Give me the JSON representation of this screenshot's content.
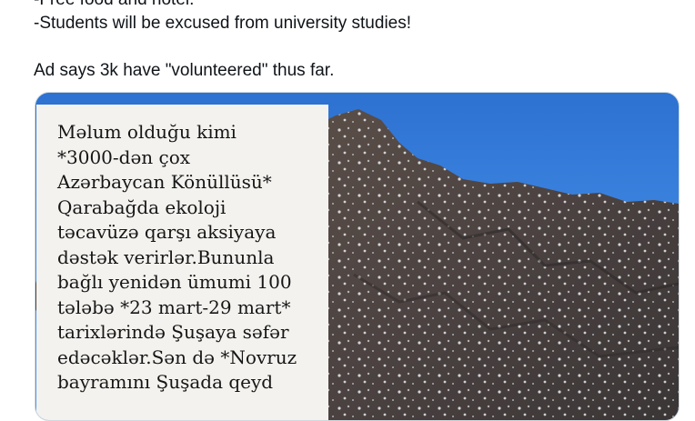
{
  "tweet": {
    "lines": [
      "-Free food and hotel.",
      "-Students will be excused from university studies!",
      "",
      "Ad says 3k have \"volunteered\" thus far."
    ]
  },
  "media": {
    "overlay_lines": [
      "Məlum olduğu kimi",
      "*3000-dən çox",
      "Azərbaycan Könüllüsü*",
      "Qarabağda ekoloji",
      "təcavüzə qarşı aksiyaya",
      "dəstək verirlər.Bununla",
      "bağlı yenidən ümumi 100",
      "tələbə *23 mart-29 mart*",
      "tarixlərində Şuşaya səfər",
      "edəcəklər.Sən də *Novruz",
      "bayramını Şuşada qeyd"
    ]
  }
}
